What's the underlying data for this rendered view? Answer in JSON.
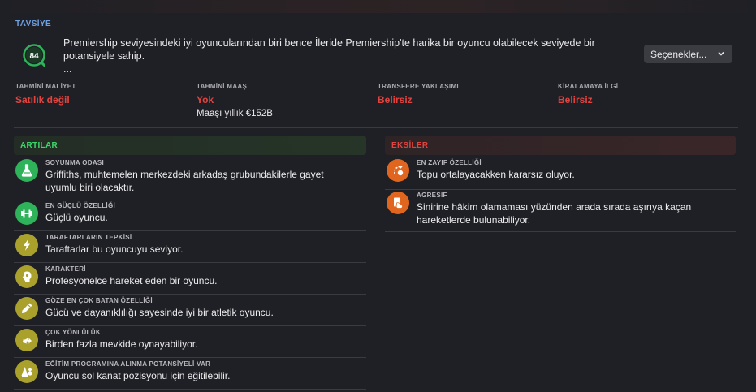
{
  "recommendation": {
    "label": "TAVSİYE",
    "rating": "84",
    "text_line1": "Premiership seviyesindeki iyi oyuncularından biri bence İleride Premiership'te harika bir oyuncu olabilecek seviyede bir",
    "text_line2": "potansiyele sahip.",
    "text_line3": "...",
    "options_label": "Seçenekler...",
    "rating_color": "#2fb35a"
  },
  "info": [
    {
      "label": "TAHMİNİ MALİYET",
      "value": "Satılık değil",
      "sub": ""
    },
    {
      "label": "TAHMİNİ MAAŞ",
      "value": "Yok",
      "sub": "Maaşı yıllık €152B"
    },
    {
      "label": "TRANSFERE YAKLAŞIMI",
      "value": "Belirsiz",
      "sub": ""
    },
    {
      "label": "KİRALAMAYA İLGİ",
      "value": "Belirsiz",
      "sub": ""
    }
  ],
  "pros": {
    "title": "ARTILAR",
    "color": "#3ed66c",
    "items": [
      {
        "title": "SOYUNMA ODASI",
        "line1": "Griffiths, muhtemelen merkezdeki arkadaş grubundakilerle gayet",
        "line2": "uyumlu biri olacaktır.",
        "icon": "flask-icon"
      },
      {
        "title": "EN GÜÇLÜ ÖZELLİĞİ",
        "line1": "Güçlü oyuncu.",
        "line2": "",
        "icon": "dumbbell-icon"
      },
      {
        "title": "TARAFTARLARIN TEPKİSİ",
        "line1": "Taraftarlar bu oyuncuyu seviyor.",
        "line2": "",
        "icon": "lightning-icon"
      },
      {
        "title": "KARAKTERİ",
        "line1": "Profesyonelce hareket eden bir oyuncu.",
        "line2": "",
        "icon": "head-icon"
      },
      {
        "title": "GÖZE EN ÇOK BATAN ÖZELLİĞİ",
        "line1": "Gücü ve dayanıklılığı sayesinde iyi bir atletik oyuncu.",
        "line2": "",
        "icon": "pen-icon"
      },
      {
        "title": "ÇOK YÖNLÜLÜK",
        "line1": "Birden fazla mevkide oynayabiliyor.",
        "line2": "",
        "icon": "swap-arrows-icon"
      },
      {
        "title": "EĞİTİM PROGRAMINA ALINMA POTANSİYELİ VAR",
        "line1": "Oyuncu sol kanat pozisyonu için eğitilebilir.",
        "line2": "",
        "icon": "cone-icon"
      }
    ]
  },
  "cons": {
    "title": "EKSİLER",
    "color": "#e3433f",
    "items": [
      {
        "title": "EN ZAYIF ÖZELLİĞİ",
        "line1": "Topu ortalayacakken kararsız oluyor.",
        "line2": "",
        "icon": "cross-ball-icon"
      },
      {
        "title": "AGRESİF",
        "line1": "Sinirine hâkim olamaması yüzünden arada sırada aşırıya kaçan",
        "line2": "hareketlerde bulunabiliyor.",
        "icon": "card-icon"
      }
    ]
  }
}
